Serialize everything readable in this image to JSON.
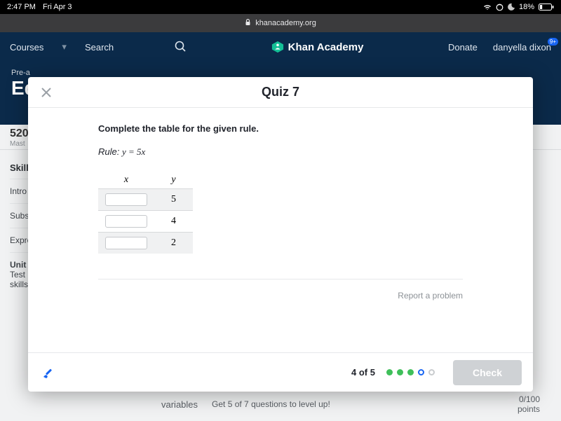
{
  "statusbar": {
    "time": "2:47 PM",
    "date": "Fri Apr 3",
    "battery_pct": "18%",
    "wifi_icon": "wifi",
    "orientation_icon": "orientation-lock",
    "moon_icon": "do-not-disturb"
  },
  "browser": {
    "lock": "🔒",
    "url": "khanacademy.org"
  },
  "kh_header": {
    "courses": "Courses",
    "search": "Search",
    "brand": "Khan Academy",
    "donate": "Donate",
    "user": "danyella dixon",
    "notif_badge": "9+"
  },
  "behind": {
    "pre": "Pre-a",
    "eq": "Eq",
    "score": "520",
    "mast": "Mast",
    "skill_h": "Skill",
    "items": [
      "Intro",
      "Subs",
      "Expre"
    ],
    "unit": "Unit",
    "unit_sub1": "Test",
    "unit_sub2": "skills",
    "variables": "variables",
    "hint": "Get 5 of 7 questions to level up!",
    "pts1": "0/100",
    "pts2": "points"
  },
  "modal": {
    "title": "Quiz 7",
    "prompt": "Complete the table for the given rule.",
    "rule_label": "Rule:",
    "rule_math": "y = 5x",
    "col_x": "x",
    "col_y": "y",
    "rows": [
      {
        "y": "5"
      },
      {
        "y": "4"
      },
      {
        "y": "2"
      }
    ],
    "report": "Report a problem",
    "progress": "4 of 5",
    "check": "Check"
  }
}
